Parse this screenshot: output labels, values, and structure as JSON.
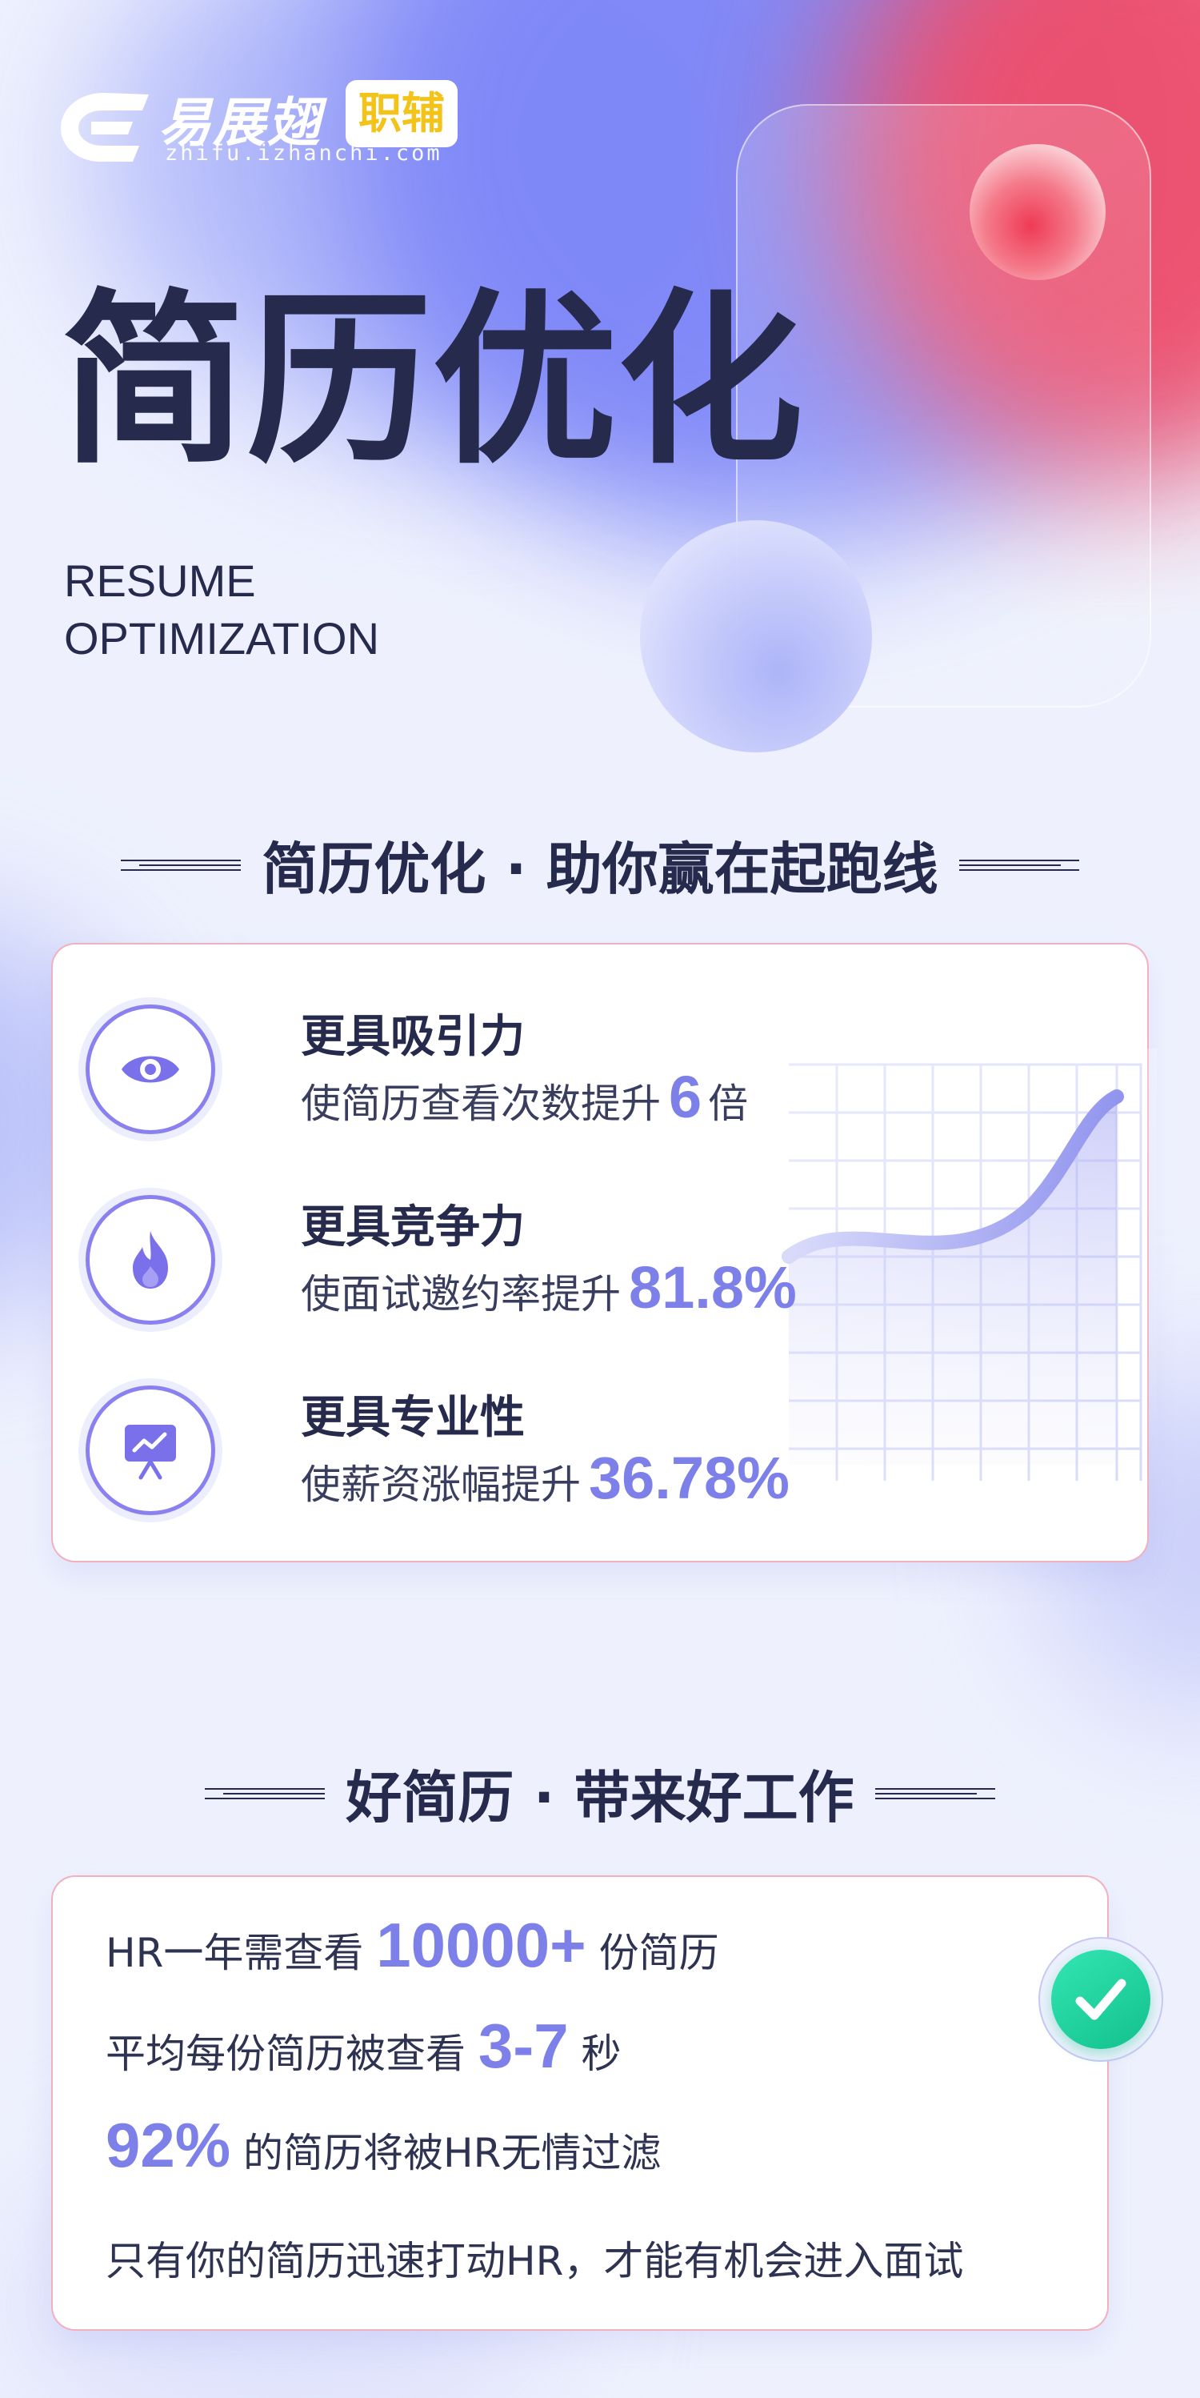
{
  "logo": {
    "brand": "易展翅",
    "tag": "职辅",
    "domain": "zhifu.izhanchi.com"
  },
  "hero": {
    "title": "简历优化",
    "subtitle_line1": "RESUME",
    "subtitle_line2": "OPTIMIZATION"
  },
  "section1": {
    "heading": "简历优化 · 助你赢在起跑线",
    "features": [
      {
        "icon": "eye-icon",
        "title": "更具吸引力",
        "desc_prefix": "使简历查看次数提升",
        "value": "6",
        "desc_suffix": "倍"
      },
      {
        "icon": "flame-icon",
        "title": "更具竞争力",
        "desc_prefix": "使面试邀约率提升",
        "value": "81.8%",
        "desc_suffix": ""
      },
      {
        "icon": "presentation-chart-icon",
        "title": "更具专业性",
        "desc_prefix": "使薪资涨幅提升",
        "value": "36.78%",
        "desc_suffix": ""
      }
    ]
  },
  "section2": {
    "heading": "好简历 · 带来好工作",
    "stats": [
      {
        "prefix": "HR一年需查看",
        "value": "10000+",
        "suffix": "份简历"
      },
      {
        "prefix": "平均每份简历被查看",
        "value": "3-7",
        "suffix": "秒"
      },
      {
        "prefix": "",
        "value": "92%",
        "suffix": "的简历将被HR无情过滤"
      },
      {
        "prefix": "只有你的简历迅速打动HR，才能有机会进入面试",
        "value": "",
        "suffix": ""
      }
    ]
  },
  "colors": {
    "accent": "#7c80e8",
    "dark": "#262a4c",
    "check": "#12c08d"
  }
}
